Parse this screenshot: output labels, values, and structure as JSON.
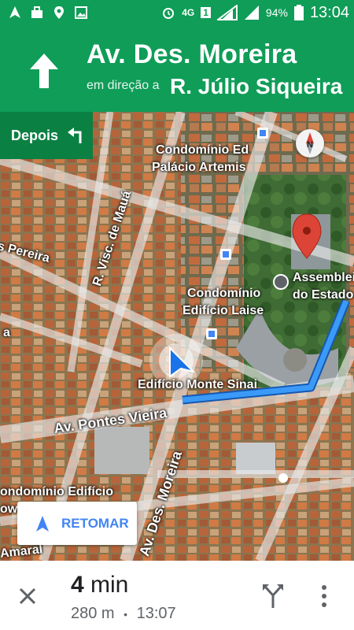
{
  "status_bar": {
    "network": "4G",
    "sim": "1",
    "battery": "94%",
    "time": "13:04",
    "icons": [
      "navigation-icon",
      "briefcase-icon",
      "location-pin-icon",
      "image-icon",
      "alarm-icon",
      "signal-icon",
      "battery-icon"
    ]
  },
  "nav": {
    "direction_icon": "straight-arrow-icon",
    "street": "Av. Des. Moreira",
    "toward_label": "em direção a",
    "toward_street": "R. Júlio Siqueira",
    "then_label": "Depois",
    "then_icon": "turn-left-icon"
  },
  "map": {
    "labels": {
      "condo_artemis_1": "Condomínio Ed",
      "condo_artemis_2": "Palácio Artemis",
      "condo_laise_1": "Condomínio",
      "condo_laise_2": "Edifício Laise",
      "monte_sinai": "Edifício Monte Sinai",
      "assembleia_1": "Assembleia",
      "assembleia_2": "do Estado d",
      "pontes_vieira": "Av. Pontes Vieira",
      "visc_maua": "R. Visc. de Mauá",
      "des_moreira": "Av. Des. Moreira",
      "pereira": "s Pereira",
      "left_a": "a",
      "condo_bottom": "ondomínio Edifício",
      "owe": "owe",
      "amaral": "Amaral"
    },
    "compass_label": "N",
    "colors": {
      "route": "#1a73e8",
      "pin": "#db4437",
      "header": "#0f9d58",
      "then": "#0b8043"
    }
  },
  "recenter": {
    "label": "RETOMAR"
  },
  "trip": {
    "eta_value": "4",
    "eta_unit": "min",
    "distance": "280 m",
    "separator": "•",
    "arrival": "13:07"
  }
}
